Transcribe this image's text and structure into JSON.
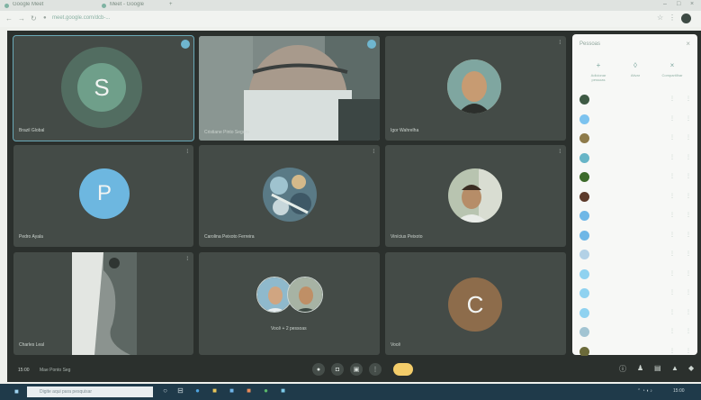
{
  "browser": {
    "tabs": [
      {
        "label": "Google Meet"
      },
      {
        "label": "Meet - Google"
      },
      {
        "label": "+"
      }
    ],
    "url": "meet.google.com/dcb-...",
    "window_controls": [
      "–",
      "□",
      "×"
    ]
  },
  "tiles": [
    {
      "name": "Brazil Global",
      "initial": "S",
      "kind": "avatar",
      "avatar_color": "#6f9f8a",
      "ring_color": "#8fb69f"
    },
    {
      "name": "Cristiane Pinto Seguro",
      "kind": "video"
    },
    {
      "name": "Igor Wahrelha",
      "kind": "photo"
    },
    {
      "name": "Pedro Ayala",
      "initial": "P",
      "kind": "avatar",
      "avatar_color": "#6db7e0"
    },
    {
      "name": "Carolina Peixoto Ferreira",
      "kind": "photo"
    },
    {
      "name": "Vinícius Peixoto",
      "kind": "photo"
    },
    {
      "name": "Charles Leal",
      "kind": "video"
    },
    {
      "name": "Você + 2 pessoas",
      "kind": "group"
    },
    {
      "name": "Você",
      "initial": "C",
      "kind": "avatar",
      "avatar_color": "#8d6c4b"
    }
  ],
  "panel": {
    "title": "Pessoas",
    "close": "×",
    "actions": [
      {
        "label": "Adicionar pessoas",
        "icon": "add-person-icon"
      },
      {
        "label": "Ativar",
        "icon": "mic-icon"
      },
      {
        "label": "Compartilhar",
        "icon": "share-icon"
      }
    ],
    "participants": [
      {
        "color": "#3e5a44"
      },
      {
        "color": "#7cc3ef"
      },
      {
        "color": "#8e7b4a"
      },
      {
        "color": "#67b5c7"
      },
      {
        "color": "#3c6a2a"
      },
      {
        "color": "#5c3a2a"
      },
      {
        "color": "#6fb7e6"
      },
      {
        "color": "#6fb7e6"
      },
      {
        "color": "#b3d1e6"
      },
      {
        "color": "#8fd2f0"
      },
      {
        "color": "#8fd2f0"
      },
      {
        "color": "#8fd2f0"
      },
      {
        "color": "#a2c4d2"
      },
      {
        "color": "#6b6a3a"
      }
    ]
  },
  "bottom": {
    "time": "15:00",
    "meeting_title": "Mae Ponto Seg"
  },
  "taskbar": {
    "search_placeholder": "Digite aqui para pesquisar",
    "tray_text": "15:00"
  }
}
